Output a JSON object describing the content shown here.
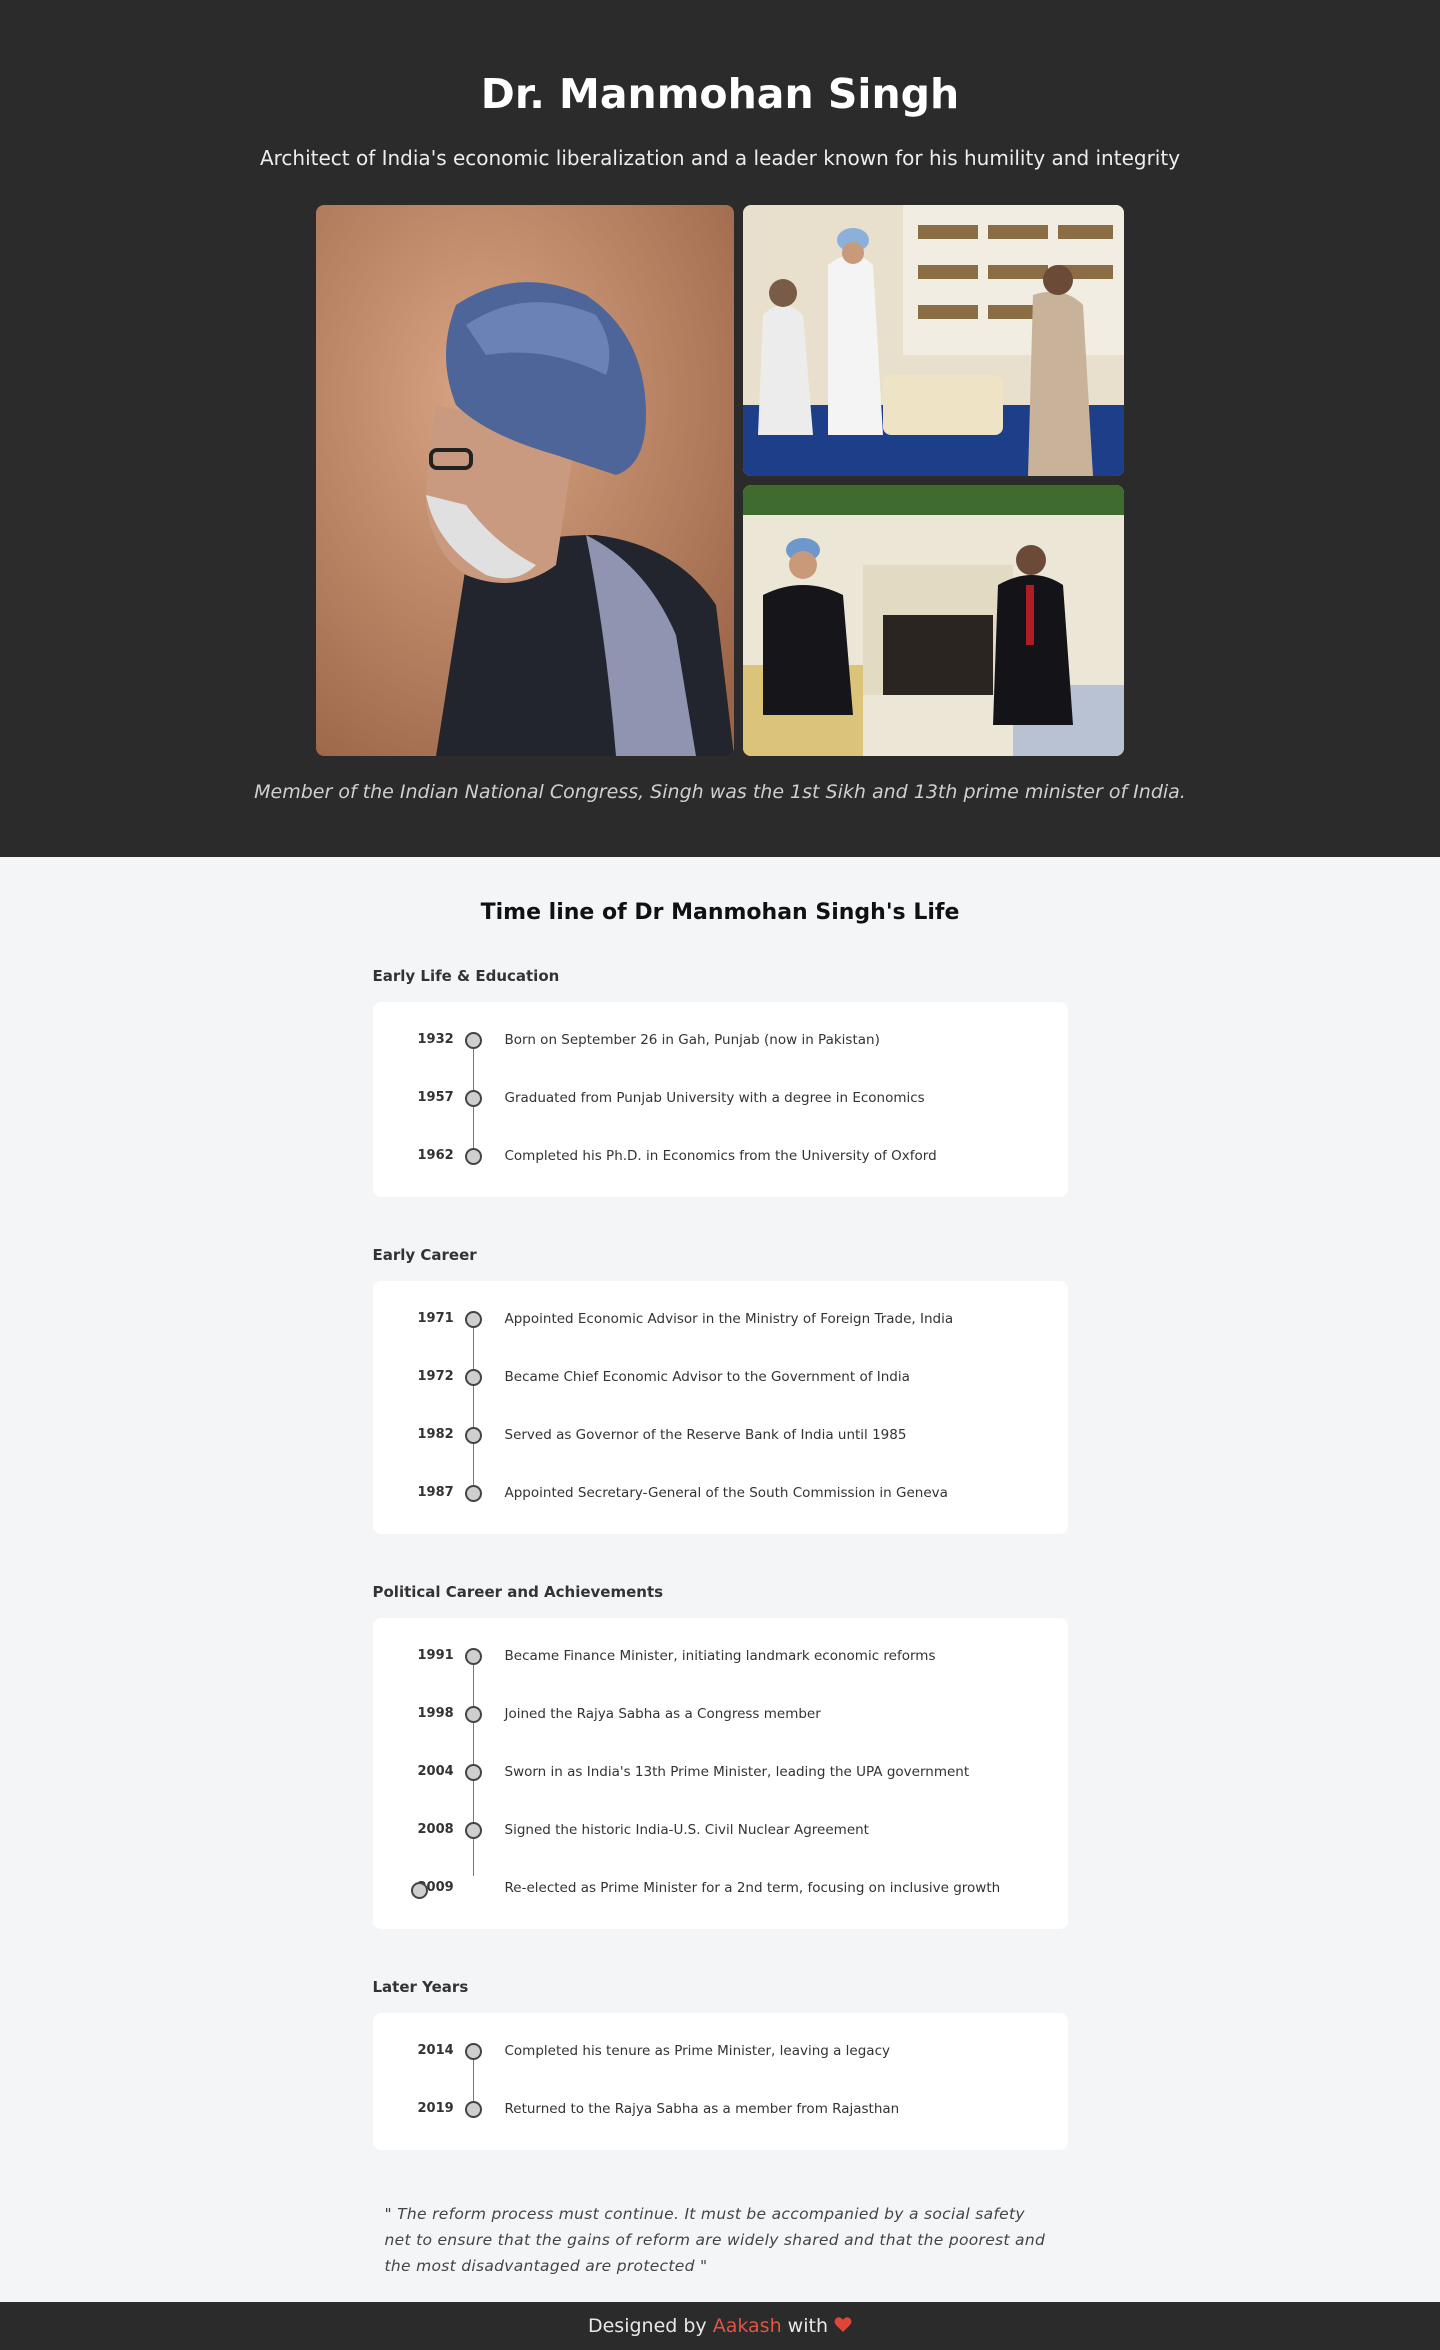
{
  "hero": {
    "title": "Dr. Manmohan Singh",
    "subtitle": "Architect of India's economic liberalization and a leader known for his humility and integrity",
    "caption": "Member of the Indian National Congress, Singh was the 1st Sikh and 13th prime minister of India.",
    "photos": [
      "portrait-photo",
      "meeting-photo",
      "white-house-photo"
    ]
  },
  "timeline": {
    "heading": "Time line of Dr Manmohan Singh's Life",
    "periods": [
      {
        "title": "Early Life & Education",
        "events": [
          {
            "year": "1932",
            "text": "Born on September 26 in Gah, Punjab (now in Pakistan)"
          },
          {
            "year": "1957",
            "text": "Graduated from Punjab University with a degree in Economics"
          },
          {
            "year": "1962",
            "text": "Completed his Ph.D. in Economics from the University of Oxford"
          }
        ]
      },
      {
        "title": "Early Career",
        "events": [
          {
            "year": "1971",
            "text": "Appointed Economic Advisor in the Ministry of Foreign Trade, India"
          },
          {
            "year": "1972",
            "text": "Became Chief Economic Advisor to the Government of India"
          },
          {
            "year": "1982",
            "text": "Served as Governor of the Reserve Bank of India until 1985"
          },
          {
            "year": "1987",
            "text": "Appointed Secretary-General of the South Commission in Geneva"
          }
        ]
      },
      {
        "title": "Political Career and Achievements",
        "events": [
          {
            "year": "1991",
            "text": "Became Finance Minister, initiating landmark economic reforms"
          },
          {
            "year": "1998",
            "text": "Joined the Rajya Sabha as a Congress member"
          },
          {
            "year": "2004",
            "text": "Sworn in as India's 13th Prime Minister, leading the UPA government"
          },
          {
            "year": "2008",
            "text": "Signed the historic India-U.S. Civil Nuclear Agreement"
          },
          {
            "year": "2009",
            "text": "Re-elected as Prime Minister for a 2nd term, focusing on inclusive growth"
          }
        ]
      },
      {
        "title": "Later Years",
        "events": [
          {
            "year": "2014",
            "text": "Completed his tenure as Prime Minister, leaving a legacy"
          },
          {
            "year": "2019",
            "text": "Returned to the Rajya Sabha as a member from Rajasthan"
          }
        ]
      }
    ]
  },
  "quote": "\" The reform process must continue. It must be accompanied by a social safety net to ensure that the gains of reform are widely shared and that the poorest and the most disadvantaged are protected \"",
  "footer": {
    "prefix": "Designed by",
    "author": "Aakash",
    "suffix": "with",
    "icon": "heart-icon",
    "accent_color": "#e05544"
  }
}
